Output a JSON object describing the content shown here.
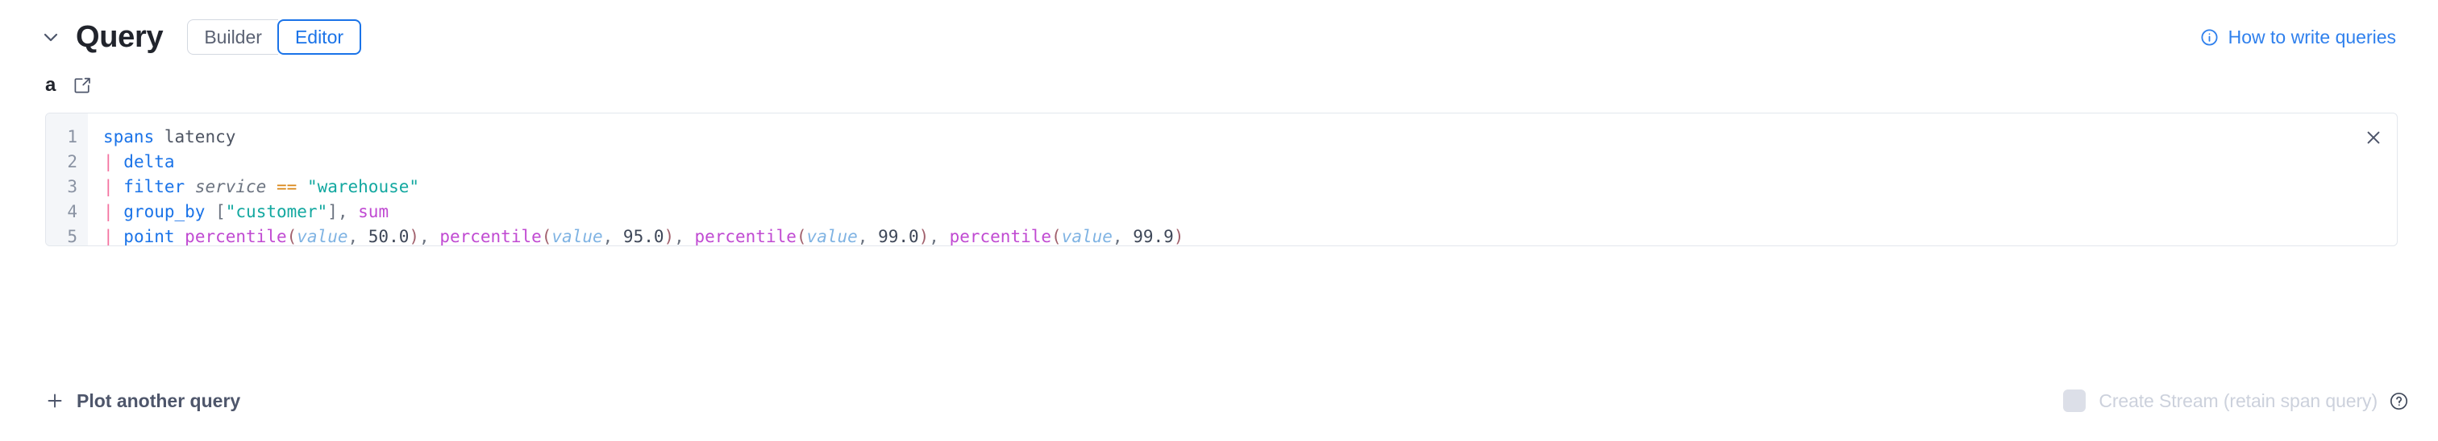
{
  "header": {
    "collapse_icon": "chevron-down-icon",
    "title": "Query",
    "mode_toggle": {
      "options": [
        "Builder",
        "Editor"
      ],
      "selected": "Editor"
    },
    "help_link": {
      "icon": "info-circle-icon",
      "label": "How to write queries"
    }
  },
  "query": {
    "label": "a",
    "edit_icon": "edit-pencil-icon",
    "close_icon": "close-icon",
    "line_numbers": [
      "1",
      "2",
      "3",
      "4",
      "5"
    ],
    "lines": [
      {
        "number": "1",
        "text": "spans latency",
        "tokens": [
          {
            "t": "spans",
            "k": "cmd"
          },
          {
            "t": " ",
            "k": "plain"
          },
          {
            "t": "latency",
            "k": "plain"
          }
        ]
      },
      {
        "number": "2",
        "text": "| delta",
        "tokens": [
          {
            "t": "| ",
            "k": "pipe"
          },
          {
            "t": "delta",
            "k": "cmd"
          }
        ]
      },
      {
        "number": "3",
        "text": "| filter service == \"warehouse\"",
        "tokens": [
          {
            "t": "| ",
            "k": "pipe"
          },
          {
            "t": "filter",
            "k": "cmd"
          },
          {
            "t": " ",
            "k": "plain"
          },
          {
            "t": "service",
            "k": "field"
          },
          {
            "t": " ",
            "k": "plain"
          },
          {
            "t": "==",
            "k": "op"
          },
          {
            "t": " ",
            "k": "plain"
          },
          {
            "t": "\"warehouse\"",
            "k": "str"
          }
        ]
      },
      {
        "number": "4",
        "text": "| group_by [\"customer\"], sum",
        "tokens": [
          {
            "t": "| ",
            "k": "pipe"
          },
          {
            "t": "group_by",
            "k": "cmd"
          },
          {
            "t": " ",
            "k": "plain"
          },
          {
            "t": "[",
            "k": "punct"
          },
          {
            "t": "\"customer\"",
            "k": "str"
          },
          {
            "t": "]",
            "k": "punct"
          },
          {
            "t": ", ",
            "k": "punct"
          },
          {
            "t": "sum",
            "k": "fn"
          }
        ]
      },
      {
        "number": "5",
        "text": "| point percentile(value, 50.0), percentile(value, 95.0), percentile(value, 99.0), percentile(value, 99.9)",
        "tokens": [
          {
            "t": "| ",
            "k": "pipe"
          },
          {
            "t": "point",
            "k": "cmd"
          },
          {
            "t": " ",
            "k": "plain"
          },
          {
            "t": "percentile",
            "k": "fn"
          },
          {
            "t": "(",
            "k": "paren"
          },
          {
            "t": "value",
            "k": "arg"
          },
          {
            "t": ", ",
            "k": "punct"
          },
          {
            "t": "50.0",
            "k": "num"
          },
          {
            "t": ")",
            "k": "paren"
          },
          {
            "t": ", ",
            "k": "punct"
          },
          {
            "t": "percentile",
            "k": "fn"
          },
          {
            "t": "(",
            "k": "paren"
          },
          {
            "t": "value",
            "k": "arg"
          },
          {
            "t": ", ",
            "k": "punct"
          },
          {
            "t": "95.0",
            "k": "num"
          },
          {
            "t": ")",
            "k": "paren"
          },
          {
            "t": ", ",
            "k": "punct"
          },
          {
            "t": "percentile",
            "k": "fn"
          },
          {
            "t": "(",
            "k": "paren"
          },
          {
            "t": "value",
            "k": "arg"
          },
          {
            "t": ", ",
            "k": "punct"
          },
          {
            "t": "99.0",
            "k": "num"
          },
          {
            "t": ")",
            "k": "paren"
          },
          {
            "t": ", ",
            "k": "punct"
          },
          {
            "t": "percentile",
            "k": "fn"
          },
          {
            "t": "(",
            "k": "paren"
          },
          {
            "t": "value",
            "k": "arg"
          },
          {
            "t": ", ",
            "k": "punct"
          },
          {
            "t": "99.9",
            "k": "num"
          },
          {
            "t": ")",
            "k": "paren"
          }
        ]
      }
    ]
  },
  "footer": {
    "plot_another": {
      "icon": "plus-icon",
      "label": "Plot another query"
    },
    "create_stream": {
      "checked": false,
      "disabled": true,
      "label": "Create Stream (retain span query)",
      "help_icon": "question-circle-icon"
    }
  },
  "colors": {
    "accent_blue": "#1a73e8",
    "link_blue": "#2f80ed",
    "pipe_pink": "#f472a0",
    "string_teal": "#13a8a0",
    "function_magenta": "#c04ad2",
    "operator_orange": "#d98514",
    "gutter_bg": "#f4f6f9",
    "border": "#e3e7ed"
  }
}
